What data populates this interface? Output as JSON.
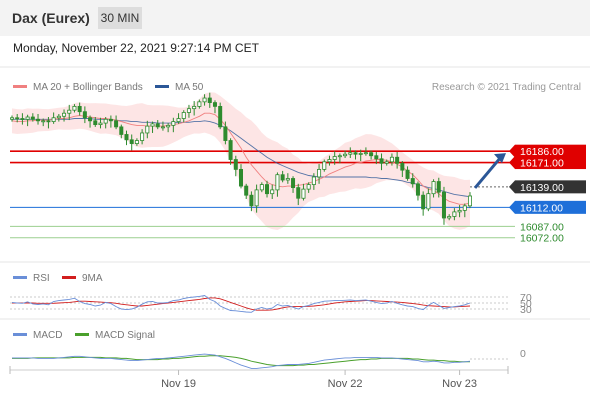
{
  "header": {
    "title": "Dax (Eurex)",
    "interval": "30 MIN"
  },
  "datetime": "Monday, November 22, 2021 9:27:14 PM CET",
  "legend": {
    "ma20_label": "MA 20 + Bollinger Bands",
    "ma50_label": "MA 50",
    "copyright": "Research © 2021 Trading Central",
    "rsi_label": "RSI",
    "rsi_ma_label": "9MA",
    "macd_label": "MACD",
    "macd_signal_label": "MACD Signal"
  },
  "colors": {
    "ma20": "#f08080",
    "ma50": "#2b5797",
    "bollinger_fill": "#fde0e0",
    "resistance": "#e00000",
    "current": "#333333",
    "support_blue": "#1e6fd9",
    "support_green": "#2e8b2e",
    "candle": "#2e8b2e",
    "rsi": "#6a8fd8",
    "rsi_ma": "#d21e1e",
    "macd": "#6a8fd8",
    "macd_signal": "#4aa02c",
    "arrow": "#2b5797"
  },
  "chart_data": [
    {
      "type": "candlestick",
      "title": "Dax (Eurex)",
      "ylim": [
        16040,
        16260
      ],
      "x_ticks": [
        "Nov 19",
        "Nov 22",
        "Nov 23"
      ],
      "levels": [
        {
          "label": "16186.00",
          "value": 16186,
          "kind": "resistance"
        },
        {
          "label": "16171.00",
          "value": 16171,
          "kind": "resistance"
        },
        {
          "label": "16139.00",
          "value": 16139,
          "kind": "current"
        },
        {
          "label": "16112.00",
          "value": 16112,
          "kind": "support"
        },
        {
          "label": "16087.00",
          "value": 16087,
          "kind": "support"
        },
        {
          "label": "16072.00",
          "value": 16072,
          "kind": "support"
        }
      ],
      "close": [
        16230,
        16229,
        16228,
        16231,
        16228,
        16226,
        16226,
        16225,
        16230,
        16232,
        16236,
        16240,
        16245,
        16238,
        16230,
        16226,
        16221,
        16223,
        16228,
        16226,
        16218,
        16208,
        16201,
        16196,
        16200,
        16210,
        16219,
        16222,
        16218,
        16218,
        16220,
        16225,
        16229,
        16237,
        16242,
        16245,
        16251,
        16256,
        16250,
        16245,
        16218,
        16200,
        16175,
        16162,
        16140,
        16128,
        16114,
        16135,
        16142,
        16130,
        16135,
        16155,
        16148,
        16150,
        16138,
        16124,
        16136,
        16142,
        16152,
        16162,
        16172,
        16175,
        16179,
        16180,
        16182,
        16184,
        16182,
        16183,
        16184,
        16180,
        16176,
        16170,
        16172,
        16178,
        16170,
        16161,
        16150,
        16143,
        16128,
        16110,
        16130,
        16146,
        16132,
        16098,
        16100,
        16106,
        16108,
        16114,
        16127
      ],
      "ma20": [
        16226,
        16225,
        16225,
        16226,
        16226,
        16227,
        16227,
        16227,
        16228,
        16229,
        16229,
        16230,
        16232,
        16233,
        16232,
        16231,
        16230,
        16229,
        16229,
        16228,
        16227,
        16225,
        16223,
        16221,
        16220,
        16220,
        16219,
        16219,
        16219,
        16219,
        16220,
        16221,
        16222,
        16224,
        16226,
        16229,
        16232,
        16236,
        16236,
        16234,
        16228,
        16220,
        16210,
        16200,
        16190,
        16178,
        16168,
        16160,
        16152,
        16145,
        16142,
        16140,
        16139,
        16140,
        16140,
        16141,
        16142,
        16144,
        16146,
        16149,
        16152,
        16156,
        16159,
        16162,
        16165,
        16167,
        16170,
        16171,
        16173,
        16174,
        16175,
        16175,
        16174,
        16172,
        16169,
        16165,
        16160,
        16155,
        16148,
        16140,
        16136,
        16134,
        16130,
        16124,
        16120,
        16118,
        16116,
        16116,
        16118
      ],
      "ma50": [
        16228,
        16228,
        16228,
        16228,
        16228,
        16228,
        16228,
        16228,
        16228,
        16228,
        16228,
        16228,
        16229,
        16229,
        16229,
        16229,
        16228,
        16228,
        16228,
        16228,
        16227,
        16226,
        16226,
        16225,
        16225,
        16224,
        16224,
        16224,
        16223,
        16223,
        16223,
        16223,
        16224,
        16224,
        16224,
        16225,
        16225,
        16226,
        16225,
        16223,
        16220,
        16217,
        16213,
        16208,
        16203,
        16198,
        16193,
        16188,
        16183,
        16178,
        16174,
        16170,
        16167,
        16164,
        16161,
        16158,
        16156,
        16154,
        16153,
        16152,
        16152,
        16152,
        16152,
        16152,
        16152,
        16152,
        16152,
        16152,
        16152,
        16151,
        16151,
        16150,
        16150,
        16149,
        16148,
        16147,
        16145,
        16144,
        16142,
        16140,
        16138,
        16137,
        16135,
        16133,
        16131,
        16129,
        16128,
        16127,
        16126
      ]
    },
    {
      "type": "line",
      "title": "RSI",
      "ylim": [
        0,
        100
      ],
      "y_ticks": [
        70,
        50,
        30
      ],
      "series": [
        {
          "name": "RSI",
          "values": [
            52,
            50,
            49,
            54,
            47,
            45,
            47,
            44,
            55,
            58,
            60,
            62,
            66,
            55,
            48,
            45,
            40,
            43,
            52,
            48,
            38,
            30,
            28,
            30,
            36,
            46,
            54,
            55,
            50,
            50,
            52,
            58,
            60,
            65,
            68,
            70,
            72,
            75,
            62,
            55,
            40,
            32,
            25,
            24,
            22,
            20,
            19,
            30,
            35,
            30,
            33,
            45,
            40,
            42,
            36,
            30,
            38,
            42,
            48,
            52,
            56,
            57,
            58,
            58,
            59,
            60,
            58,
            59,
            60,
            56,
            52,
            48,
            50,
            55,
            49,
            44,
            40,
            38,
            32,
            28,
            42,
            52,
            42,
            32,
            35,
            38,
            40,
            44,
            50
          ]
        },
        {
          "name": "9MA",
          "values": [
            50,
            50,
            50,
            50,
            50,
            49,
            49,
            49,
            49,
            50,
            51,
            52,
            54,
            56,
            56,
            55,
            54,
            53,
            52,
            51,
            49,
            46,
            44,
            42,
            40,
            40,
            42,
            44,
            46,
            48,
            50,
            52,
            54,
            56,
            58,
            60,
            62,
            65,
            67,
            67,
            64,
            58,
            52,
            46,
            40,
            34,
            29,
            26,
            26,
            26,
            27,
            30,
            34,
            37,
            38,
            38,
            38,
            39,
            40,
            42,
            44,
            47,
            50,
            52,
            54,
            55,
            56,
            57,
            58,
            58,
            57,
            56,
            55,
            54,
            53,
            52,
            50,
            48,
            46,
            43,
            41,
            40,
            39,
            38,
            37,
            37,
            38,
            39,
            40
          ]
        }
      ]
    },
    {
      "type": "line",
      "title": "MACD",
      "y_ticks": [
        0
      ],
      "series": [
        {
          "name": "MACD",
          "values": [
            2,
            2,
            2,
            2,
            2,
            1,
            1,
            1,
            1,
            2,
            3,
            4,
            5,
            5,
            4,
            3,
            2,
            1,
            1,
            1,
            0,
            -1,
            -2,
            -3,
            -3,
            -2,
            -1,
            0,
            1,
            1,
            2,
            3,
            4,
            5,
            6,
            7,
            8,
            9,
            8,
            7,
            4,
            1,
            -3,
            -7,
            -11,
            -14,
            -17,
            -17,
            -16,
            -15,
            -14,
            -12,
            -11,
            -10,
            -10,
            -10,
            -9,
            -8,
            -6,
            -4,
            -2,
            -1,
            0,
            1,
            2,
            2,
            3,
            3,
            3,
            3,
            3,
            2,
            2,
            2,
            1,
            0,
            -1,
            -2,
            -3,
            -5,
            -5,
            -4,
            -5,
            -7,
            -7,
            -6,
            -6,
            -5,
            -4
          ]
        },
        {
          "name": "MACD Signal",
          "values": [
            1,
            1,
            1,
            1,
            2,
            2,
            2,
            2,
            2,
            2,
            2,
            2,
            3,
            3,
            3,
            3,
            3,
            3,
            2,
            2,
            2,
            1,
            1,
            0,
            -1,
            -1,
            -1,
            -1,
            -1,
            0,
            0,
            1,
            1,
            2,
            3,
            4,
            5,
            5,
            6,
            6,
            6,
            5,
            4,
            3,
            1,
            -1,
            -4,
            -6,
            -8,
            -10,
            -11,
            -12,
            -12,
            -12,
            -12,
            -11,
            -11,
            -10,
            -10,
            -9,
            -8,
            -7,
            -6,
            -5,
            -4,
            -3,
            -2,
            -1,
            -1,
            0,
            0,
            1,
            1,
            1,
            1,
            1,
            1,
            0,
            0,
            -1,
            -2,
            -2,
            -3,
            -3,
            -4,
            -4,
            -5,
            -5,
            -5
          ]
        }
      ]
    }
  ]
}
